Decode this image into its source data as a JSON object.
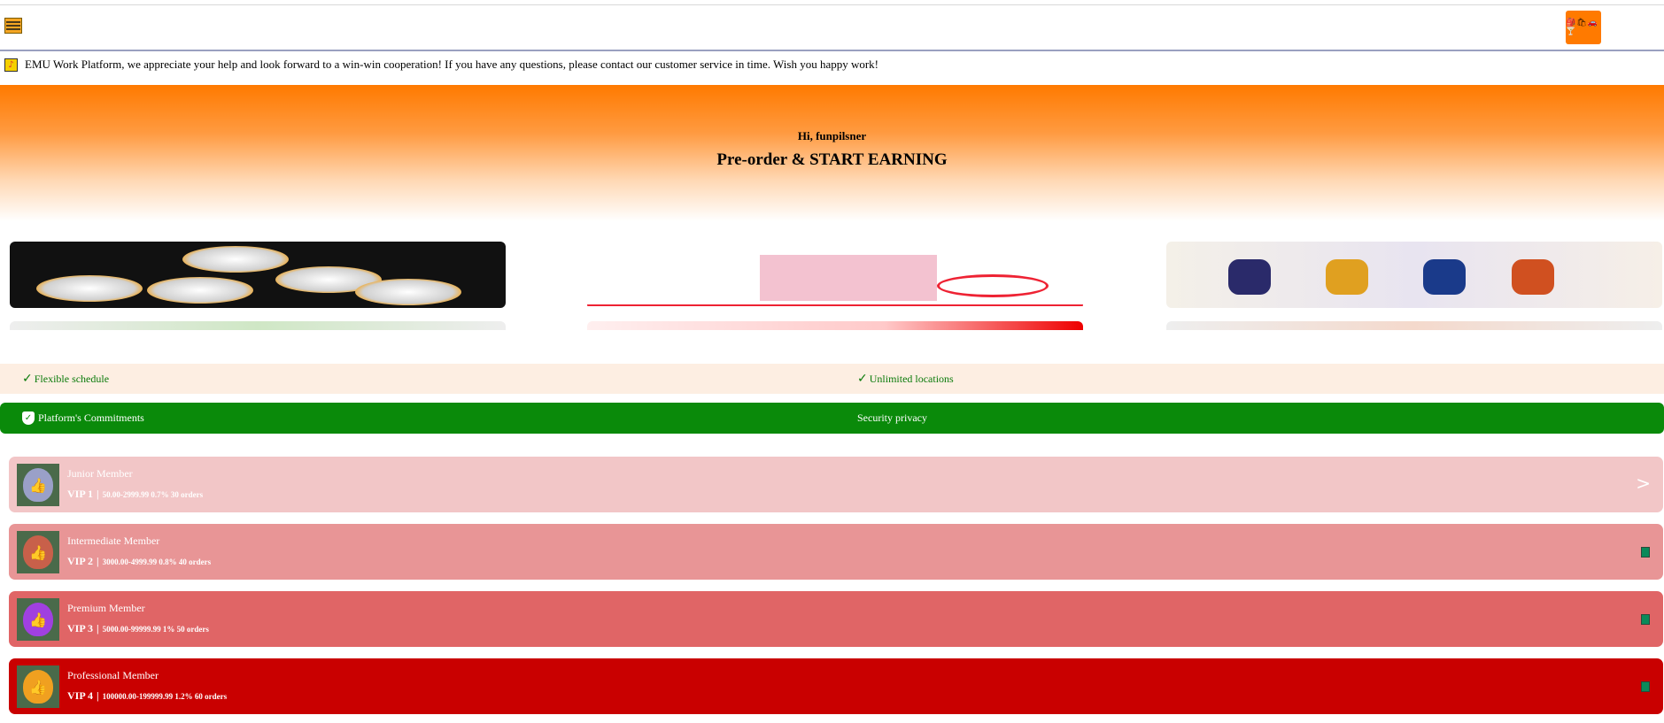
{
  "header": {
    "menu_icon": "hamburger-menu-icon",
    "logo_glyphs": "🎒🛍🚗🍸",
    "logo_icon": "emu-logo-icon"
  },
  "notice": {
    "icon": "bell-notice-icon",
    "text": "EMU Work Platform, we appreciate your help and look forward to a win-win cooperation! If you have any questions, please contact our customer service in time. Wish you happy work!"
  },
  "hero": {
    "greeting": "Hi, funpilsner",
    "headline": "Pre-order & START EARNING",
    "colors": {
      "top": "#ff7a00",
      "bottom": "#ffffff"
    }
  },
  "features": [
    {
      "label": "Flexible schedule",
      "icon": "check-icon"
    },
    {
      "label": "Unlimited locations",
      "icon": "check-icon"
    }
  ],
  "commitments": {
    "icon": "shield-check-icon",
    "label": "Platform's Commitments",
    "right_label": "Security privacy",
    "color": "#0a8a0a"
  },
  "vip_levels": [
    {
      "name": "Junior Member",
      "level": "VIP 1",
      "details": "50.00-2999.99 0.7% 30 orders",
      "state": "current",
      "indicator": ">",
      "color": "#f2c6c7"
    },
    {
      "name": "Intermediate Member",
      "level": "VIP 2",
      "details": "3000.00-4999.99 0.8% 40 orders",
      "state": "locked",
      "color": "#e89596"
    },
    {
      "name": "Premium Member",
      "level": "VIP 3",
      "details": "5000.00-99999.99 1% 50 orders",
      "state": "locked",
      "color": "#e06566"
    },
    {
      "name": "Professional Member",
      "level": "VIP 4",
      "details": "100000.00-199999.99 1.2% 60 orders",
      "state": "locked",
      "color": "#c90000"
    }
  ]
}
